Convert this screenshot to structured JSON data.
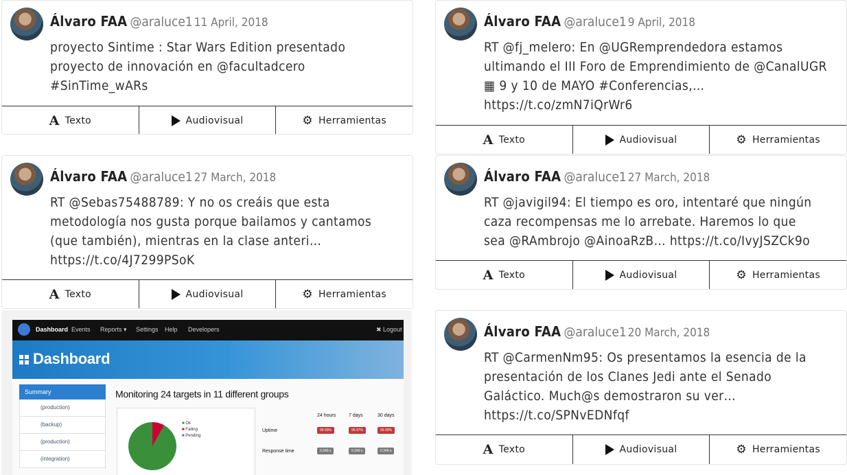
{
  "actions": {
    "text": "Texto",
    "av": "Audiovisual",
    "tools": "Herramientas"
  },
  "tweets": [
    {
      "name": "Álvaro FAA",
      "handle": "@araluce1",
      "date": "11 April, 2018",
      "text": "proyecto Sintime : Star Wars Edition presentado\nproyecto de innovación en @facultadcero\n#SinTime_wARs"
    },
    {
      "name": "Álvaro FAA",
      "handle": "@araluce1",
      "date": "27 March, 2018",
      "text": "RT @Sebas75488789: Y no os creáis que esta\nmetodología nos gusta porque bailamos y cantamos\n(que también), mientras en la clase anteri…\nhttps://t.co/4J7299PSoK"
    },
    {
      "name": "Álvaro FAA",
      "handle": "@araluce1",
      "date": "9 April, 2018",
      "text": "RT @fj_melero: En @UGRemprendedora estamos\nultimando el III Foro de Emprendimiento de @CanalUGR\n▦ 9 y 10 de MAYO #Conferencias,…\nhttps://t.co/zmN7iQrWr6"
    },
    {
      "name": "Álvaro FAA",
      "handle": "@araluce1",
      "date": "27 March, 2018",
      "text": "RT @javigil94: El tiempo es oro, intentaré que ningún\ncaza recompensas me lo arrebate. Haremos lo que\nsea @RAmbrojo @AinoaRzB… https://t.co/IvyJSZCk9o"
    },
    {
      "name": "Álvaro FAA",
      "handle": "@araluce1",
      "date": "20 March, 2018",
      "text": "RT @CarmenNm95: Os presentamos la esencia de la\npresentación de los Clanes Jedi ante el Senado\nGaláctico. Much@s demostraron su ver…\nhttps://t.co/SPNvEDNfqf"
    }
  ],
  "dashboard": {
    "nav": [
      "Dashboard",
      "Events",
      "Reports ▾",
      "Settings",
      "Help",
      "Developers"
    ],
    "logout": "✖ Logout",
    "title": "Dashboard",
    "summary": "Summary",
    "side_items": [
      "(production)",
      "(backup)",
      "(production)",
      "(integration)"
    ],
    "monitoring": "Monitoring 24 targets in 11 different groups",
    "legend": [
      "Ok",
      "Failing",
      "Pending"
    ],
    "cols": [
      "24 hours",
      "7 days",
      "30 days"
    ],
    "rows": [
      {
        "label": "Uptime",
        "values": [
          "99.93%",
          "99.97%",
          "99.99%"
        ]
      },
      {
        "label": "Response time",
        "values": [
          "0.349 s",
          "0.349 s",
          "0.349 s"
        ]
      }
    ],
    "colors": {
      "uptime_badge": "#c0393b",
      "resp_badge": "#7a7a7a"
    }
  }
}
